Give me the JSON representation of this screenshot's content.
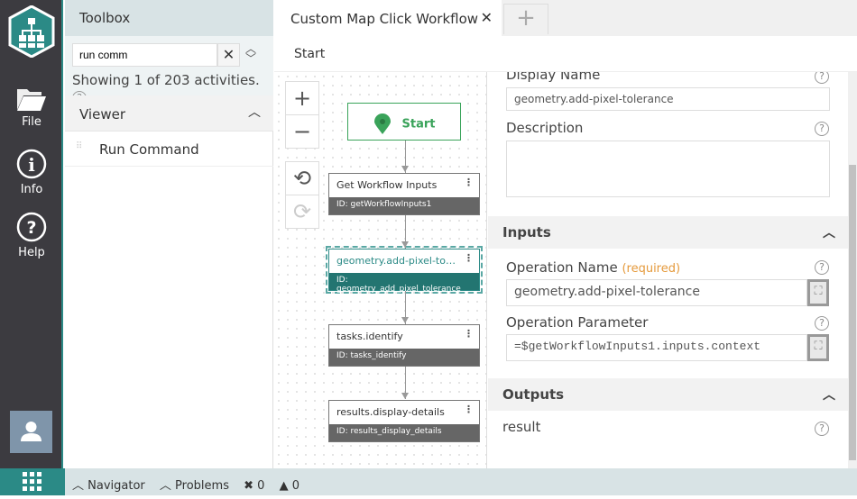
{
  "nav": {
    "items": [
      {
        "label": "File",
        "icon": "folder-icon"
      },
      {
        "label": "Info",
        "icon": "info-icon"
      },
      {
        "label": "Help",
        "icon": "help-icon"
      }
    ]
  },
  "toolbox": {
    "title": "Toolbox",
    "search_value": "run comm",
    "showing": "Showing 1 of 203 activities.",
    "group": "Viewer",
    "items": [
      "Run Command"
    ]
  },
  "tabs": {
    "active": "Custom Map Click Workflow",
    "add": "+"
  },
  "breadcrumb": "Start",
  "canvas": {
    "start": "Start",
    "nodes": [
      {
        "title": "Get Workflow Inputs",
        "id": "ID: getWorkflowInputs1",
        "selected": false
      },
      {
        "title": "geometry.add-pixel-tolerance",
        "id": "ID: geometry_add_pixel_tolerance",
        "selected": true
      },
      {
        "title": "tasks.identify",
        "id": "ID: tasks_identify",
        "selected": false
      },
      {
        "title": "results.display-details",
        "id": "ID: results_display_details",
        "selected": false
      }
    ]
  },
  "props": {
    "display_name_label": "Display Name",
    "display_name_value": "geometry.add-pixel-tolerance",
    "description_label": "Description",
    "description_value": "",
    "inputs_title": "Inputs",
    "op_name_label": "Operation Name",
    "required": "(required)",
    "op_name_value": "geometry.add-pixel-tolerance",
    "op_param_label": "Operation Parameter",
    "op_param_value": "=$getWorkflowInputs1.inputs.context",
    "outputs_title": "Outputs",
    "output_result": "result"
  },
  "status": {
    "navigator": "Navigator",
    "problems": "Problems",
    "errors": "0",
    "warnings": "0"
  },
  "colors": {
    "accent": "#2b8a86",
    "start": "#3aa35a",
    "required": "#e59a3c"
  }
}
